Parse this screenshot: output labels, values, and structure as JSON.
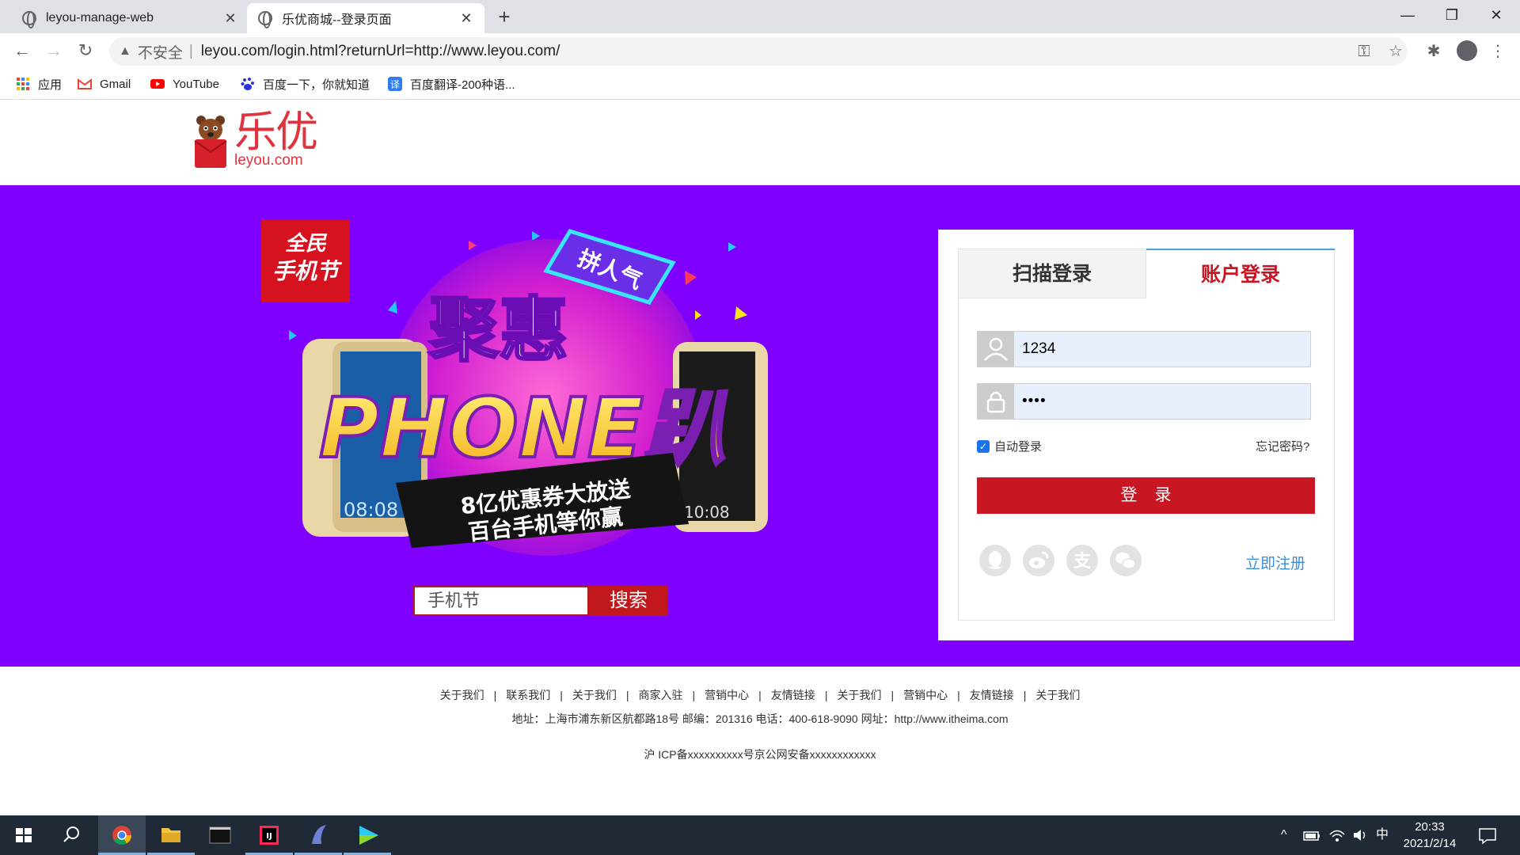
{
  "browser": {
    "tabs": [
      {
        "label": "leyou-manage-web"
      },
      {
        "label": "乐优商城--登录页面"
      }
    ],
    "address": {
      "security_label": "不安全",
      "separator": "|",
      "url": "leyou.com/login.html?returnUrl=http://www.leyou.com/"
    },
    "bookmarks": [
      {
        "label": "应用",
        "icon": "apps-grid-icon"
      },
      {
        "label": "Gmail",
        "icon": "gmail-icon"
      },
      {
        "label": "YouTube",
        "icon": "youtube-icon"
      },
      {
        "label": "百度一下，你就知道",
        "icon": "baidu-paw-icon"
      },
      {
        "label": "百度翻译-200种语...",
        "icon": "baidu-translate-icon"
      }
    ]
  },
  "header": {
    "logo_cn": "乐优",
    "logo_en": "leyou.com"
  },
  "promo": {
    "badge_line1": "全民",
    "badge_line2": "手机节",
    "tag": "拼人气",
    "headline": "聚惠",
    "headline2": "PHONE趴",
    "sub1": "8亿优惠券大放送",
    "sub2": "百台手机等你赢",
    "phone_time_left": "08:08",
    "phone_time_right": "10:08",
    "search_value": "手机节",
    "search_button": "搜索"
  },
  "login": {
    "tab_scan": "扫描登录",
    "tab_account": "账户登录",
    "username_value": "1234",
    "password_value": "••••",
    "auto_login_label": "自动登录",
    "auto_login_checked": true,
    "forgot_label": "忘记密码?",
    "submit_label": "登录",
    "register_label": "立即注册",
    "social_icons": [
      "qq-icon",
      "weibo-icon",
      "alipay-icon",
      "wechat-icon"
    ]
  },
  "footer": {
    "links": [
      "关于我们",
      "联系我们",
      "关于我们",
      "商家入驻",
      "营销中心",
      "友情链接",
      "关于我们",
      "营销中心",
      "友情链接",
      "关于我们"
    ],
    "address": "地址：上海市浦东新区航都路18号 邮编：201316 电话：400-618-9090 网址：http://www.itheima.com",
    "icp": "沪 ICP备xxxxxxxxxx号京公网安备xxxxxxxxxxxx"
  },
  "taskbar": {
    "ime": "中",
    "time": "20:33",
    "date": "2021/2/14"
  },
  "colors": {
    "band_purple": "#8000ff",
    "brand_red": "#c81623",
    "link_blue": "#3b8fd6"
  }
}
